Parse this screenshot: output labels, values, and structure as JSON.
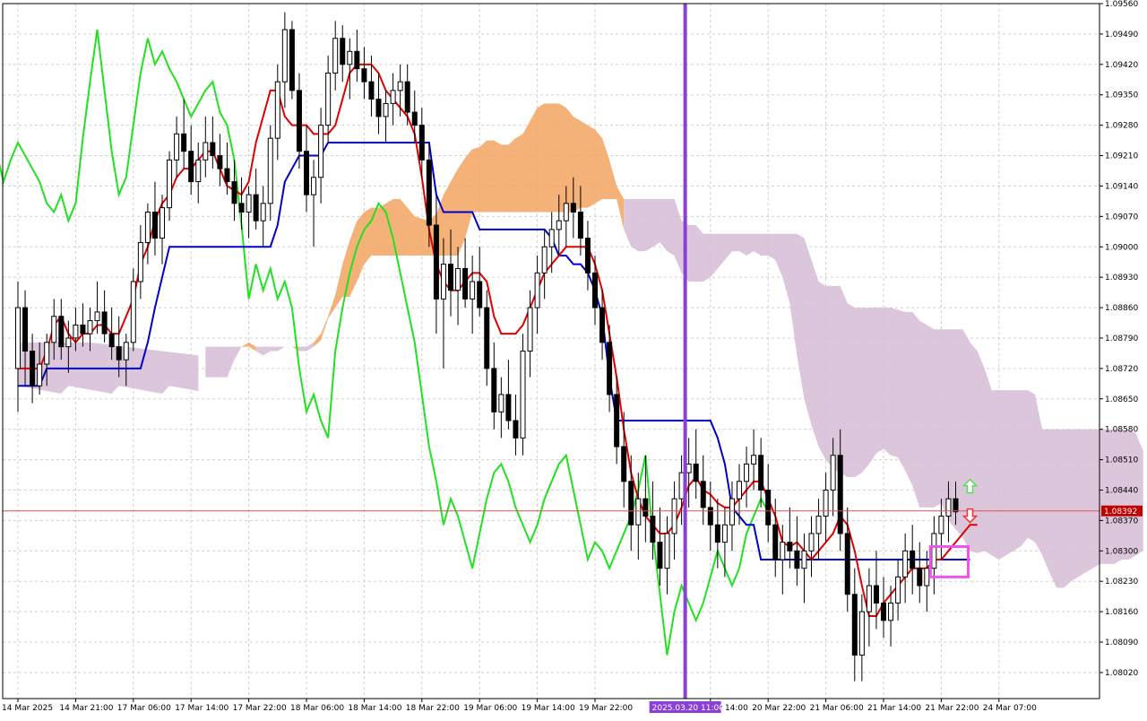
{
  "chart_data": {
    "type": "candlestick",
    "title": "",
    "instrument": "",
    "ylim": [
      1.0796,
      1.0956
    ],
    "y_ticks": [
      "1.09560",
      "1.09490",
      "1.09420",
      "1.09350",
      "1.09280",
      "1.09210",
      "1.09140",
      "1.09070",
      "1.09000",
      "1.08930",
      "1.08860",
      "1.08790",
      "1.08720",
      "1.08650",
      "1.08580",
      "1.08510",
      "1.08440",
      "1.08370",
      "1.08300",
      "1.08230",
      "1.08160",
      "1.08090",
      "1.08020"
    ],
    "x_ticks": [
      {
        "i": 0,
        "label": "14 Mar 2025"
      },
      {
        "i": 8,
        "label": "14 Mar 21:00"
      },
      {
        "i": 16,
        "label": "17 Mar 06:00"
      },
      {
        "i": 24,
        "label": "17 Mar 14:00"
      },
      {
        "i": 32,
        "label": "17 Mar 22:00"
      },
      {
        "i": 40,
        "label": "18 Mar 06:00"
      },
      {
        "i": 48,
        "label": "18 Mar 14:00"
      },
      {
        "i": 56,
        "label": "18 Mar 22:00"
      },
      {
        "i": 64,
        "label": "19 Mar 06:00"
      },
      {
        "i": 72,
        "label": "19 Mar 14:00"
      },
      {
        "i": 80,
        "label": "19 Mar 22:00"
      },
      {
        "i": 96,
        "label": "20 Mar 14:00"
      },
      {
        "i": 104,
        "label": "20 Mar 22:00"
      },
      {
        "i": 112,
        "label": "21 Mar 06:00"
      },
      {
        "i": 120,
        "label": "21 Mar 14:00"
      },
      {
        "i": 128,
        "label": "21 Mar 22:00"
      },
      {
        "i": 136,
        "label": "24 Mar 07:00"
      }
    ],
    "current_price": "1.08392",
    "current_price_value": 1.08392,
    "vertical_marker": {
      "label": "2025.03.20 11:00",
      "i": 92.5
    },
    "colors": {
      "bull_candle": "#ffffff",
      "bear_candle": "#000000",
      "tenkan": "#e00000",
      "kijun": "#0000c8",
      "chikou": "#22e022",
      "kumo_bull": "#f2a560",
      "kumo_bear": "#d6bcd6",
      "price_line": "#e05050",
      "price_tag": "#c00000",
      "vertical_marker": "#8a3fd6",
      "highlight_box": "#ee55ee",
      "arrow_up": "#55dd55",
      "arrow_down": "#ee3333",
      "grid": "#d0d0d0"
    },
    "grid": true,
    "candles": [
      [
        1.0872,
        1.0892,
        1.0862,
        1.0886
      ],
      [
        1.0886,
        1.089,
        1.0868,
        1.0876
      ],
      [
        1.0876,
        1.088,
        1.0864,
        1.0868
      ],
      [
        1.0868,
        1.0878,
        1.0866,
        1.0873
      ],
      [
        1.0873,
        1.088,
        1.0868,
        1.0878
      ],
      [
        1.0878,
        1.0888,
        1.0874,
        1.0884
      ],
      [
        1.0884,
        1.0888,
        1.0874,
        1.0877
      ],
      [
        1.0877,
        1.0883,
        1.0871,
        1.0879
      ],
      [
        1.0879,
        1.0886,
        1.0876,
        1.0882
      ],
      [
        1.0882,
        1.0887,
        1.0877,
        1.088
      ],
      [
        1.088,
        1.0886,
        1.0876,
        1.0883
      ],
      [
        1.0883,
        1.0892,
        1.088,
        1.0885
      ],
      [
        1.0885,
        1.089,
        1.0878,
        1.088
      ],
      [
        1.088,
        1.0886,
        1.0874,
        1.0877
      ],
      [
        1.0877,
        1.0884,
        1.087,
        1.0874
      ],
      [
        1.0874,
        1.088,
        1.0868,
        1.0878
      ],
      [
        1.0878,
        1.0895,
        1.0876,
        1.0892
      ],
      [
        1.0892,
        1.0905,
        1.0888,
        1.0901
      ],
      [
        1.0901,
        1.091,
        1.0896,
        1.0908
      ],
      [
        1.0908,
        1.0915,
        1.0898,
        1.0902
      ],
      [
        1.0902,
        1.0912,
        1.0896,
        1.0909
      ],
      [
        1.0909,
        1.0922,
        1.0906,
        1.092
      ],
      [
        1.092,
        1.093,
        1.0916,
        1.0926
      ],
      [
        1.0926,
        1.0934,
        1.0918,
        1.0922
      ],
      [
        1.0922,
        1.0928,
        1.0912,
        1.0915
      ],
      [
        1.0915,
        1.0924,
        1.091,
        1.092
      ],
      [
        1.092,
        1.093,
        1.0916,
        1.0924
      ],
      [
        1.0924,
        1.093,
        1.0918,
        1.0921
      ],
      [
        1.0921,
        1.0926,
        1.0914,
        1.0918
      ],
      [
        1.0918,
        1.0924,
        1.0912,
        1.0915
      ],
      [
        1.0915,
        1.092,
        1.0906,
        1.091
      ],
      [
        1.091,
        1.0916,
        1.0904,
        1.0908
      ],
      [
        1.0908,
        1.0914,
        1.0902,
        1.0912
      ],
      [
        1.0912,
        1.0918,
        1.0904,
        1.0906
      ],
      [
        1.0906,
        1.0914,
        1.09,
        1.091
      ],
      [
        1.091,
        1.0928,
        1.0906,
        1.0925
      ],
      [
        1.0925,
        1.0942,
        1.092,
        1.0938
      ],
      [
        1.0938,
        1.0954,
        1.0932,
        1.095
      ],
      [
        1.095,
        1.0952,
        1.0934,
        1.0936
      ],
      [
        1.0936,
        1.094,
        1.0918,
        1.0922
      ],
      [
        1.0922,
        1.0928,
        1.0908,
        1.0912
      ],
      [
        1.0912,
        1.092,
        1.09,
        1.0916
      ],
      [
        1.0916,
        1.0932,
        1.091,
        1.0928
      ],
      [
        1.0928,
        1.0944,
        1.0924,
        1.094
      ],
      [
        1.094,
        1.0952,
        1.0936,
        1.0948
      ],
      [
        1.0948,
        1.0951,
        1.0938,
        1.0942
      ],
      [
        1.0942,
        1.0948,
        1.0934,
        1.0945
      ],
      [
        1.0945,
        1.095,
        1.0938,
        1.0941
      ],
      [
        1.0941,
        1.0946,
        1.0934,
        1.0938
      ],
      [
        1.0938,
        1.0944,
        1.093,
        1.0934
      ],
      [
        1.0934,
        1.094,
        1.0926,
        1.093
      ],
      [
        1.093,
        1.0936,
        1.0924,
        1.0933
      ],
      [
        1.0933,
        1.094,
        1.0928,
        1.0936
      ],
      [
        1.0936,
        1.0942,
        1.093,
        1.0938
      ],
      [
        1.0938,
        1.0942,
        1.0928,
        1.0931
      ],
      [
        1.0931,
        1.0936,
        1.0924,
        1.0928
      ],
      [
        1.0928,
        1.0932,
        1.0916,
        1.092
      ],
      [
        1.092,
        1.0924,
        1.09,
        1.0905
      ],
      [
        1.0905,
        1.0912,
        1.088,
        1.0888
      ],
      [
        1.0888,
        1.0902,
        1.0872,
        1.0896
      ],
      [
        1.0896,
        1.0904,
        1.0884,
        1.089
      ],
      [
        1.089,
        1.09,
        1.0882,
        1.0895
      ],
      [
        1.0895,
        1.0902,
        1.0886,
        1.0888
      ],
      [
        1.0888,
        1.0898,
        1.088,
        1.0892
      ],
      [
        1.0892,
        1.09,
        1.0884,
        1.0886
      ],
      [
        1.0886,
        1.089,
        1.0868,
        1.0872
      ],
      [
        1.0872,
        1.0878,
        1.0858,
        1.0862
      ],
      [
        1.0862,
        1.087,
        1.0856,
        1.0866
      ],
      [
        1.0866,
        1.0874,
        1.0858,
        1.086
      ],
      [
        1.086,
        1.0866,
        1.0852,
        1.0856
      ],
      [
        1.0856,
        1.088,
        1.0852,
        1.0876
      ],
      [
        1.0876,
        1.089,
        1.087,
        1.0886
      ],
      [
        1.0886,
        1.0898,
        1.088,
        1.0894
      ],
      [
        1.0894,
        1.0904,
        1.0888,
        1.09
      ],
      [
        1.09,
        1.0908,
        1.0894,
        1.0904
      ],
      [
        1.0904,
        1.0912,
        1.0898,
        1.0906
      ],
      [
        1.0906,
        1.0914,
        1.09,
        1.091
      ],
      [
        1.091,
        1.0916,
        1.0902,
        1.0908
      ],
      [
        1.0908,
        1.0914,
        1.0898,
        1.0902
      ],
      [
        1.0902,
        1.0906,
        1.089,
        1.0894
      ],
      [
        1.0894,
        1.0898,
        1.0882,
        1.0886
      ],
      [
        1.0886,
        1.089,
        1.0874,
        1.0878
      ],
      [
        1.0878,
        1.0882,
        1.0862,
        1.0866
      ],
      [
        1.0866,
        1.087,
        1.085,
        1.0854
      ],
      [
        1.0854,
        1.0862,
        1.084,
        1.0846
      ],
      [
        1.0846,
        1.0852,
        1.083,
        1.0836
      ],
      [
        1.0836,
        1.0848,
        1.0828,
        1.0842
      ],
      [
        1.0842,
        1.0852,
        1.0832,
        1.0838
      ],
      [
        1.0838,
        1.0846,
        1.0828,
        1.0832
      ],
      [
        1.0832,
        1.084,
        1.0822,
        1.0826
      ],
      [
        1.0826,
        1.0838,
        1.082,
        1.0834
      ],
      [
        1.0834,
        1.0846,
        1.0828,
        1.0842
      ],
      [
        1.0842,
        1.0852,
        1.0836,
        1.0848
      ],
      [
        1.0848,
        1.0856,
        1.084,
        1.085
      ],
      [
        1.085,
        1.0858,
        1.0842,
        1.0846
      ],
      [
        1.0846,
        1.0852,
        1.0836,
        1.084
      ],
      [
        1.084,
        1.0846,
        1.083,
        1.0836
      ],
      [
        1.0836,
        1.0842,
        1.0826,
        1.0832
      ],
      [
        1.0832,
        1.084,
        1.0824,
        1.0836
      ],
      [
        1.0836,
        1.0846,
        1.083,
        1.0842
      ],
      [
        1.0842,
        1.085,
        1.0836,
        1.0846
      ],
      [
        1.0846,
        1.0854,
        1.084,
        1.085
      ],
      [
        1.085,
        1.0858,
        1.0844,
        1.0852
      ],
      [
        1.0852,
        1.0856,
        1.084,
        1.0844
      ],
      [
        1.0844,
        1.085,
        1.0832,
        1.0836
      ],
      [
        1.0836,
        1.0842,
        1.0824,
        1.0828
      ],
      [
        1.0828,
        1.0836,
        1.082,
        1.0832
      ],
      [
        1.0832,
        1.084,
        1.0826,
        1.083
      ],
      [
        1.083,
        1.0838,
        1.0822,
        1.0826
      ],
      [
        1.0826,
        1.0834,
        1.0818,
        1.083
      ],
      [
        1.083,
        1.0838,
        1.0824,
        1.0834
      ],
      [
        1.0834,
        1.0842,
        1.0828,
        1.0838
      ],
      [
        1.0838,
        1.0848,
        1.0832,
        1.0844
      ],
      [
        1.0844,
        1.0856,
        1.0838,
        1.0852
      ],
      [
        1.0852,
        1.0858,
        1.083,
        1.0834
      ],
      [
        1.0834,
        1.084,
        1.0816,
        1.082
      ],
      [
        1.082,
        1.0826,
        1.08,
        1.0806
      ],
      [
        1.0806,
        1.082,
        1.08,
        1.0816
      ],
      [
        1.0816,
        1.0826,
        1.0808,
        1.0822
      ],
      [
        1.0822,
        1.083,
        1.0812,
        1.0818
      ],
      [
        1.0818,
        1.0824,
        1.081,
        1.0814
      ],
      [
        1.0814,
        1.0822,
        1.0808,
        1.0818
      ],
      [
        1.0818,
        1.0828,
        1.0814,
        1.0824
      ],
      [
        1.0824,
        1.0834,
        1.0818,
        1.083
      ],
      [
        1.083,
        1.0836,
        1.082,
        1.0826
      ],
      [
        1.0826,
        1.0832,
        1.0818,
        1.0822
      ],
      [
        1.0822,
        1.083,
        1.0816,
        1.0826
      ],
      [
        1.0826,
        1.0838,
        1.082,
        1.0834
      ],
      [
        1.0834,
        1.0842,
        1.0828,
        1.0838
      ],
      [
        1.0838,
        1.0846,
        1.0832,
        1.0842
      ],
      [
        1.0842,
        1.0846,
        1.0836,
        1.0839
      ]
    ],
    "kijun": [
      1.0868,
      1.0868,
      1.0868,
      1.0868,
      1.0872,
      1.0872,
      1.0872,
      1.0872,
      1.0872,
      1.0872,
      1.0872,
      1.0872,
      1.0872,
      1.0872,
      1.0872,
      1.0872,
      1.0872,
      1.0872,
      1.0878,
      1.0886,
      1.0893,
      1.09,
      1.09,
      1.09,
      1.09,
      1.09,
      1.09,
      1.09,
      1.09,
      1.09,
      1.09,
      1.09,
      1.09,
      1.09,
      1.09,
      1.09,
      1.0905,
      1.0915,
      1.0918,
      1.0921,
      1.0921,
      1.0921,
      1.0921,
      1.0924,
      1.0924,
      1.0924,
      1.0924,
      1.0924,
      1.0924,
      1.0924,
      1.0924,
      1.0924,
      1.0924,
      1.0924,
      1.0924,
      1.0924,
      1.0924,
      1.0924,
      1.0912,
      1.0908,
      1.0908,
      1.0908,
      1.0908,
      1.0908,
      1.0904,
      1.0904,
      1.0904,
      1.0904,
      1.0904,
      1.0904,
      1.0904,
      1.0904,
      1.0904,
      1.0904,
      1.0902,
      1.0898,
      1.0898,
      1.0896,
      1.0896,
      1.0894,
      1.089,
      1.0884,
      1.087,
      1.086,
      1.086,
      1.086,
      1.086,
      1.086,
      1.086,
      1.086,
      1.086,
      1.086,
      1.086,
      1.086,
      1.086,
      1.086,
      1.086,
      1.0856,
      1.085,
      1.084,
      1.0838,
      1.0836,
      1.0836,
      1.0828,
      1.0828,
      1.0828,
      1.0828,
      1.0828,
      1.0828,
      1.0828,
      1.0828,
      1.0828,
      1.0828,
      1.0828,
      1.0828,
      1.0828,
      1.0828,
      1.0828,
      1.0828,
      1.0828,
      1.0828,
      1.0828,
      1.0828,
      1.0828,
      1.0828,
      1.0828,
      1.0828,
      1.0828,
      1.0828,
      1.0828,
      1.0828,
      1.0828,
      1.0828
    ],
    "tenkan": [
      1.0872,
      1.0872,
      1.0872,
      1.0872,
      1.0876,
      1.0882,
      1.0884,
      1.088,
      1.0878,
      1.088,
      1.088,
      1.0882,
      1.0882,
      1.088,
      1.088,
      1.0884,
      1.0888,
      1.0896,
      1.09,
      1.0906,
      1.091,
      1.0912,
      1.0916,
      1.0918,
      1.0918,
      1.092,
      1.0922,
      1.0922,
      1.0918,
      1.0914,
      1.0913,
      1.0912,
      1.0915,
      1.0924,
      1.093,
      1.0936,
      1.0936,
      1.093,
      1.0928,
      1.0928,
      1.0928,
      1.0926,
      1.0926,
      1.0926,
      1.0928,
      1.0934,
      1.094,
      1.0942,
      1.0942,
      1.0942,
      1.094,
      1.0936,
      1.0934,
      1.0932,
      1.093,
      1.0926,
      1.0916,
      1.0904,
      1.0896,
      1.0892,
      1.089,
      1.089,
      1.0892,
      1.0894,
      1.0894,
      1.0892,
      1.0884,
      1.088,
      1.088,
      1.088,
      1.0882,
      1.0886,
      1.089,
      1.0894,
      1.0896,
      1.0898,
      1.09,
      1.09,
      1.09,
      1.09,
      1.0896,
      1.089,
      1.088,
      1.087,
      1.0858,
      1.0848,
      1.0842,
      1.0838,
      1.0836,
      1.0834,
      1.0834,
      1.0836,
      1.084,
      1.0845,
      1.0847,
      1.0844,
      1.0843,
      1.0841,
      1.084,
      1.084,
      1.0842,
      1.0844,
      1.0846,
      1.0846,
      1.0842,
      1.0838,
      1.0832,
      1.0831,
      1.0832,
      1.083,
      1.0828,
      1.083,
      1.0832,
      1.0834,
      1.0838,
      1.0836,
      1.083,
      1.0822,
      1.0815,
      1.0815,
      1.0818,
      1.082,
      1.0822,
      1.0824,
      1.0826,
      1.0826,
      1.0826,
      1.0828,
      1.0828,
      1.083,
      1.0832,
      1.0834,
      1.0836,
      1.0836
    ],
    "chikou_visible": true,
    "kumo_note": "Ichimoku cloud (Senkou A/B) shaded regions shifted forward"
  }
}
